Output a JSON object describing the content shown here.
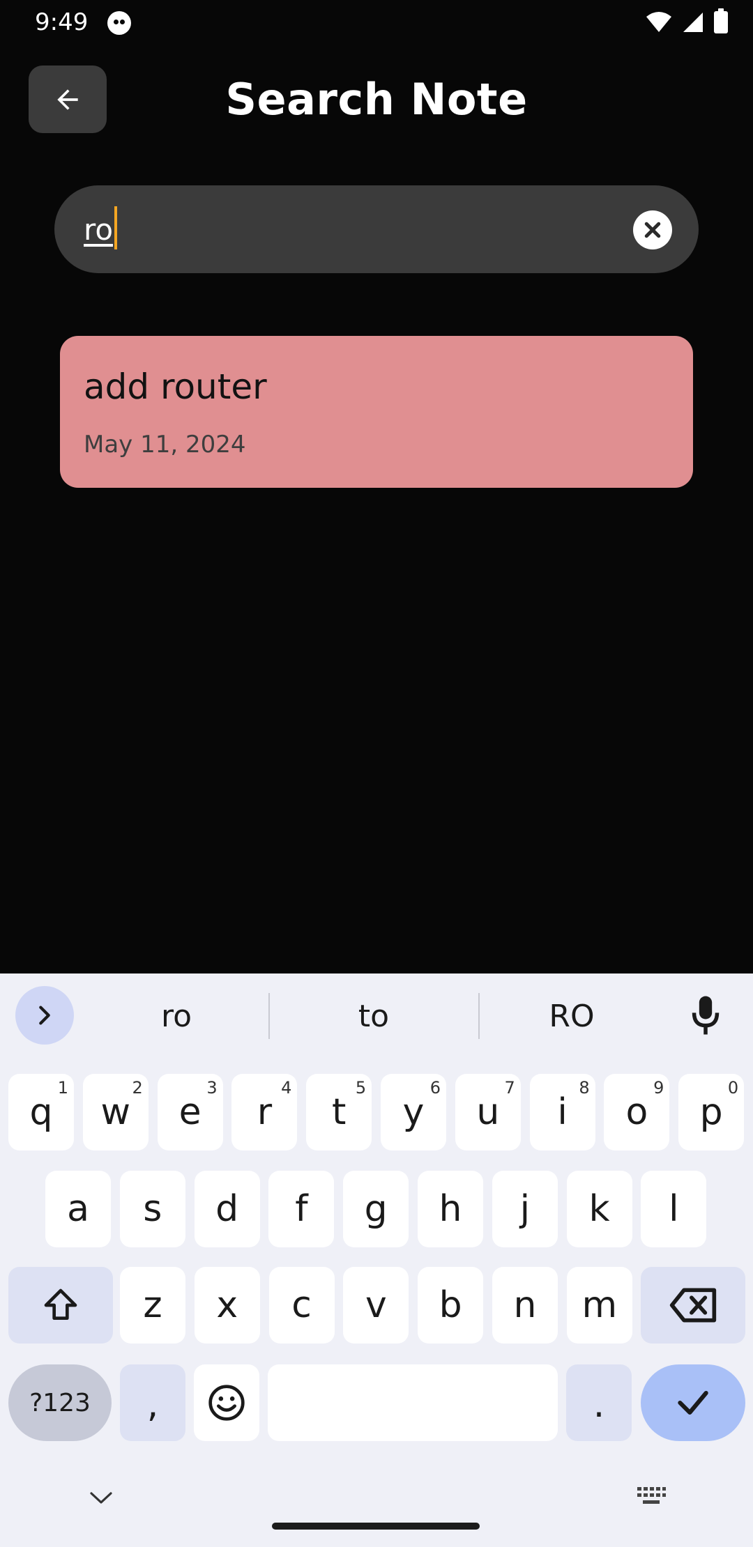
{
  "status": {
    "time": "9:49"
  },
  "header": {
    "title": "Search Note"
  },
  "search": {
    "value": "ro"
  },
  "results": [
    {
      "title": "add router",
      "date": "May 11, 2024"
    }
  ],
  "keyboard": {
    "suggestions": [
      "ro",
      "to",
      "RO"
    ],
    "row1": [
      {
        "k": "q",
        "h": "1"
      },
      {
        "k": "w",
        "h": "2"
      },
      {
        "k": "e",
        "h": "3"
      },
      {
        "k": "r",
        "h": "4"
      },
      {
        "k": "t",
        "h": "5"
      },
      {
        "k": "y",
        "h": "6"
      },
      {
        "k": "u",
        "h": "7"
      },
      {
        "k": "i",
        "h": "8"
      },
      {
        "k": "o",
        "h": "9"
      },
      {
        "k": "p",
        "h": "0"
      }
    ],
    "row2": [
      "a",
      "s",
      "d",
      "f",
      "g",
      "h",
      "j",
      "k",
      "l"
    ],
    "row3": [
      "z",
      "x",
      "c",
      "v",
      "b",
      "n",
      "m"
    ],
    "sym_label": "?123",
    "comma": ",",
    "period": "."
  },
  "colors": {
    "card": "#e08f91",
    "caret": "#f5a623",
    "enter": "#a9c0f7"
  }
}
